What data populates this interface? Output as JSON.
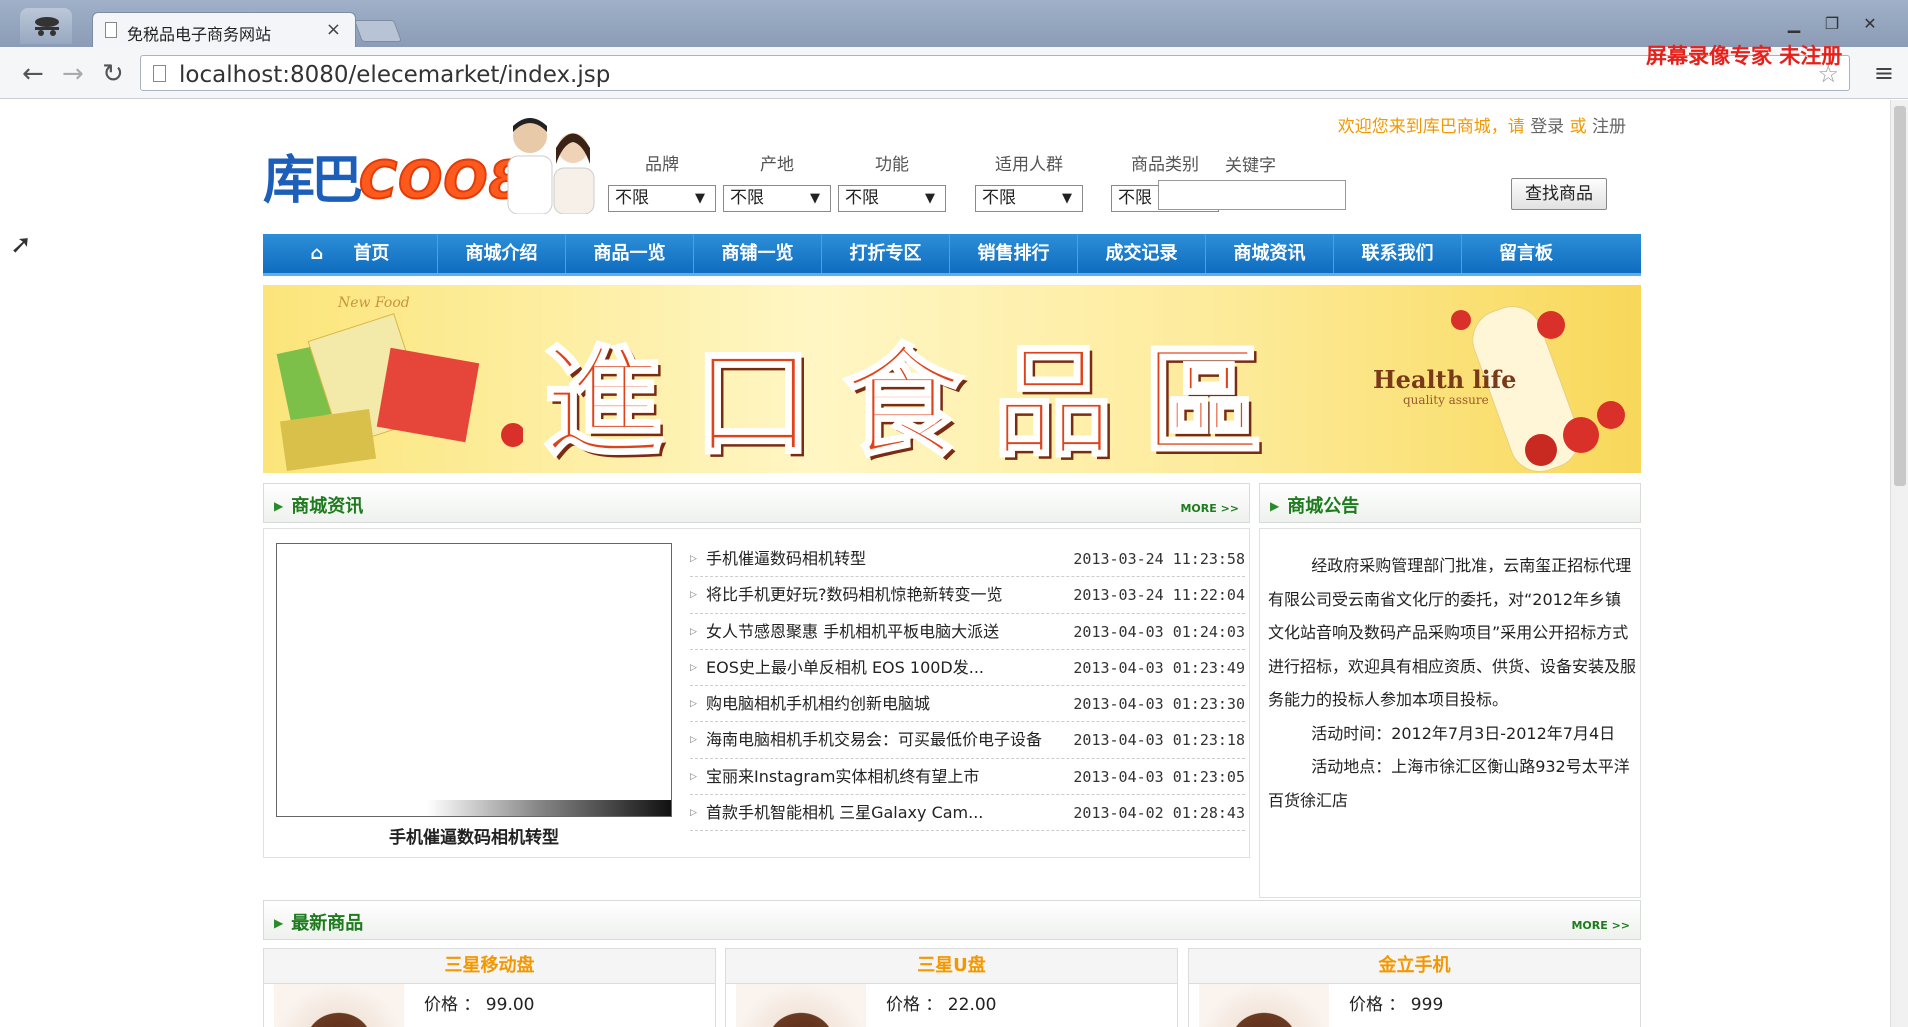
{
  "browser": {
    "tab_title": "免税品电子商务网站",
    "tab_close": "×",
    "url": "localhost:8080/elecemarket/index.jsp",
    "watermark": "屏幕录像专家  未注册"
  },
  "header": {
    "logo_cn": "库巴",
    "logo_en": "COO8",
    "welcome_text": "欢迎您来到库巴商城，请",
    "login": "登录",
    "or": "或",
    "register": "注册"
  },
  "filters": [
    {
      "label": "品牌",
      "value": "不限"
    },
    {
      "label": "产地",
      "value": "不限"
    },
    {
      "label": "功能",
      "value": "不限"
    },
    {
      "label": "适用人群",
      "value": "不限"
    },
    {
      "label": "商品类别",
      "value": "不限"
    }
  ],
  "search": {
    "label": "关键字",
    "value": "",
    "button": "查找商品"
  },
  "nav": [
    "首页",
    "商城介绍",
    "商品一览",
    "商铺一览",
    "打折专区",
    "销售排行",
    "成交记录",
    "商城资讯",
    "联系我们",
    "留言板"
  ],
  "banner": {
    "headline": "進口食品區",
    "health": "Health life",
    "quality": "quality assure",
    "newfood": "New Food"
  },
  "news_section": {
    "title": "商城资讯",
    "more": "MORE >>",
    "photo_caption": "手机催逼数码相机转型",
    "items": [
      {
        "title": "手机催逼数码相机转型",
        "date": "2013-03-24 11:23:58"
      },
      {
        "title": "将比手机更好玩?数码相机惊艳新转变一览",
        "date": "2013-03-24 11:22:04"
      },
      {
        "title": "女人节感恩聚惠 手机相机平板电脑大派送",
        "date": "2013-04-03 01:24:03"
      },
      {
        "title": "EOS史上最小单反相机 EOS 100D发...",
        "date": "2013-04-03 01:23:49"
      },
      {
        "title": "购电脑相机手机相约创新电脑城",
        "date": "2013-04-03 01:23:30"
      },
      {
        "title": "海南电脑相机手机交易会：可买最低价电子设备",
        "date": "2013-04-03 01:23:18"
      },
      {
        "title": "宝丽来Instagram实体相机终有望上市",
        "date": "2013-04-03 01:23:05"
      },
      {
        "title": "首款手机智能相机 三星Galaxy Cam...",
        "date": "2013-04-02 01:28:43"
      }
    ]
  },
  "notice_section": {
    "title": "商城公告",
    "p1": "经政府采购管理部门批准，云南玺正招标代理有限公司受云南省文化厅的委托，对“2012年乡镇文化站音响及数码产品采购项目”采用公开招标方式进行招标，欢迎具有相应资质、供货、设备安装及服务能力的投标人参加本项目投标。",
    "p2": "活动时间：2012年7月3日-2012年7月4日",
    "p3": "活动地点：上海市徐汇区衡山路932号太平洋百货徐汇店"
  },
  "products_section": {
    "title": "最新商品",
    "more": "MORE >>",
    "items": [
      {
        "name": "三星移动盘",
        "price": "价格 ： 99.00"
      },
      {
        "name": "三星U盘",
        "price": "价格 ： 22.00"
      },
      {
        "name": "金立手机",
        "price": "价格 ： 999"
      }
    ]
  }
}
